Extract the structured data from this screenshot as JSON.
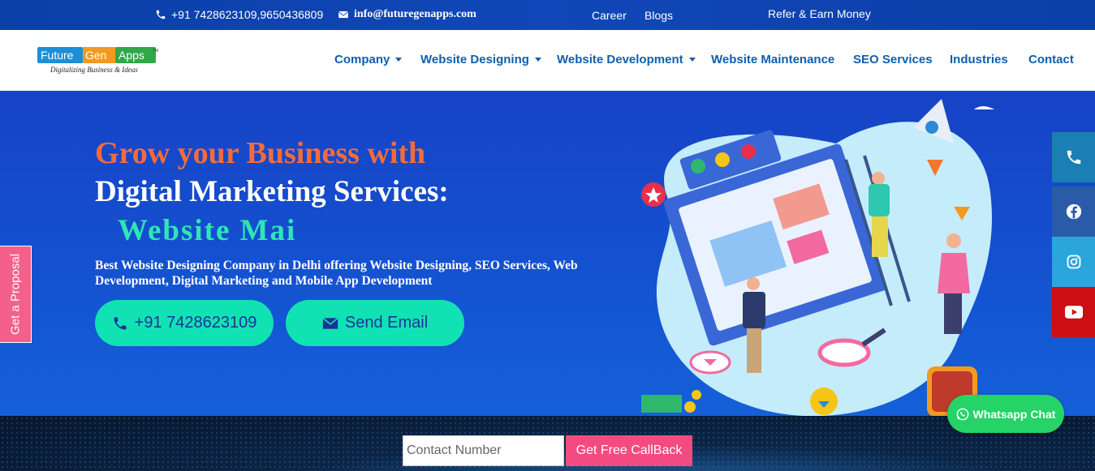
{
  "topbar": {
    "phone": "+91 7428623109,9650436809",
    "email": "info@futuregenapps.com",
    "links": [
      "Career",
      "Blogs"
    ],
    "refer": "Refer & Earn Money"
  },
  "logo": {
    "word1": "Future",
    "word2": "Gen",
    "word3": "Apps",
    "tm": "TM",
    "tagline": "Digitalizing Business & Ideas"
  },
  "nav": {
    "items": [
      {
        "label": "Company",
        "dropdown": true
      },
      {
        "label": "Website Designing",
        "dropdown": true
      },
      {
        "label": "Website Development",
        "dropdown": true
      },
      {
        "label": "Website Maintenance",
        "dropdown": false
      },
      {
        "label": "SEO Services",
        "dropdown": false
      },
      {
        "label": "Industries",
        "dropdown": false
      },
      {
        "label": "Contact",
        "dropdown": false
      }
    ]
  },
  "hero": {
    "line1": "Grow your Business with",
    "line2": "Digital Marketing Services:",
    "line3": "Website Mai",
    "subtitle": "Best Website Designing Company in Delhi offering Website Designing, SEO Services, Web Development, Digital Marketing and Mobile App Development",
    "call_button": "+91 7428623109",
    "email_button": "Send Email"
  },
  "side": {
    "proposal": "Get a Proposal",
    "social": [
      {
        "icon": "phone-icon",
        "color": "#1a7fb3"
      },
      {
        "icon": "facebook-icon",
        "color": "#2a5ba8"
      },
      {
        "icon": "instagram-icon",
        "color": "#2aa6dd"
      },
      {
        "icon": "youtube-icon",
        "color": "#cc0f12"
      }
    ]
  },
  "callback": {
    "placeholder": "Contact Number",
    "button": "Get Free CallBack"
  },
  "whatsapp": {
    "label": "Whatsapp Chat"
  },
  "colors": {
    "accent_orange": "#f56b3a",
    "accent_teal": "#2ee6b5",
    "nav_blue": "#0f5fae",
    "button_pink": "#f44a82"
  }
}
